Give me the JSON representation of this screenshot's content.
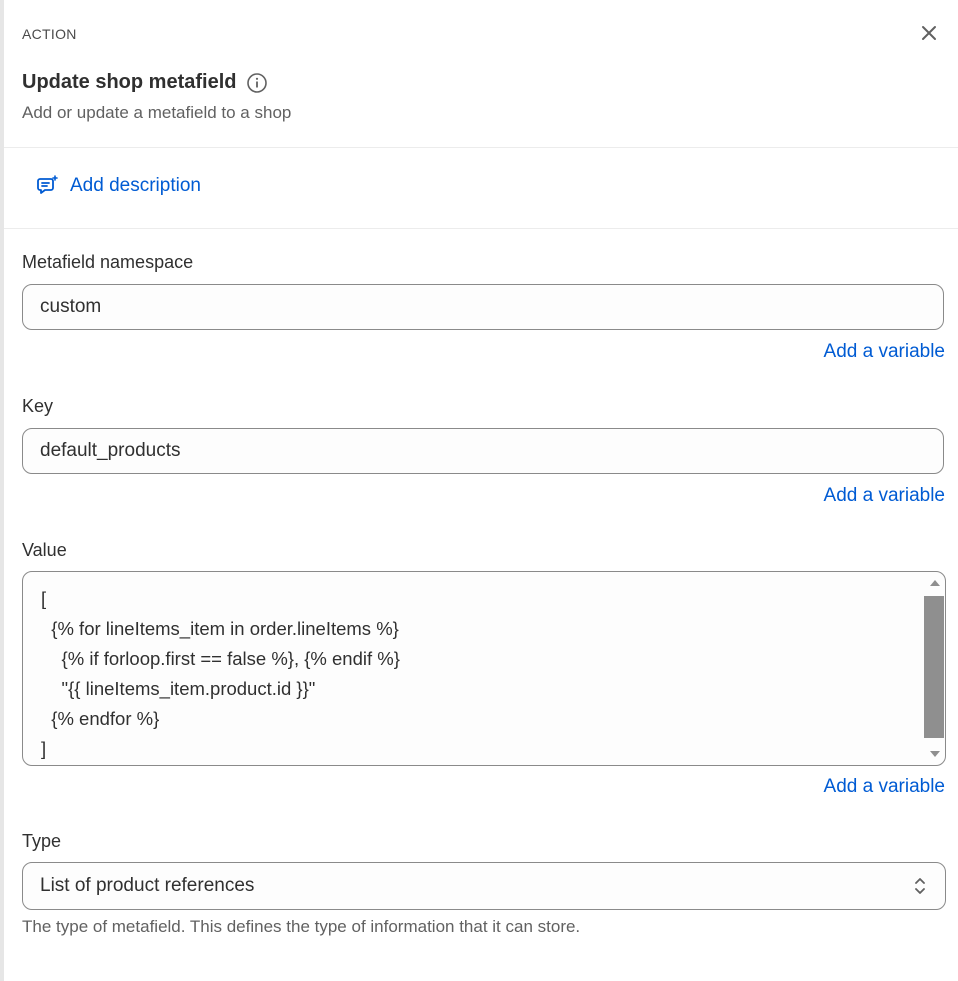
{
  "header": {
    "eyebrow": "ACTION",
    "title": "Update shop metafield",
    "subtitle": "Add or update a metafield to a shop"
  },
  "description": {
    "add_label": "Add description"
  },
  "namespace": {
    "label": "Metafield namespace",
    "value": "custom",
    "add_variable": "Add a variable"
  },
  "key": {
    "label": "Key",
    "value": "default_products",
    "add_variable": "Add a variable"
  },
  "value_field": {
    "label": "Value",
    "value": "[\n  {% for lineItems_item in order.lineItems %}\n    {% if forloop.first == false %}, {% endif %}\n    \"{{ lineItems_item.product.id }}\"\n  {% endfor %}\n]",
    "add_variable": "Add a variable"
  },
  "type_field": {
    "label": "Type",
    "selected": "List of product references",
    "help": "The type of metafield. This defines the type of information that it can store."
  },
  "colors": {
    "link": "#005bd3",
    "text": "#303030",
    "muted": "#616161",
    "border": "#8a8a8a"
  },
  "icons": [
    "close-icon",
    "info-icon",
    "comment-add-icon",
    "select-chevron-icon"
  ]
}
